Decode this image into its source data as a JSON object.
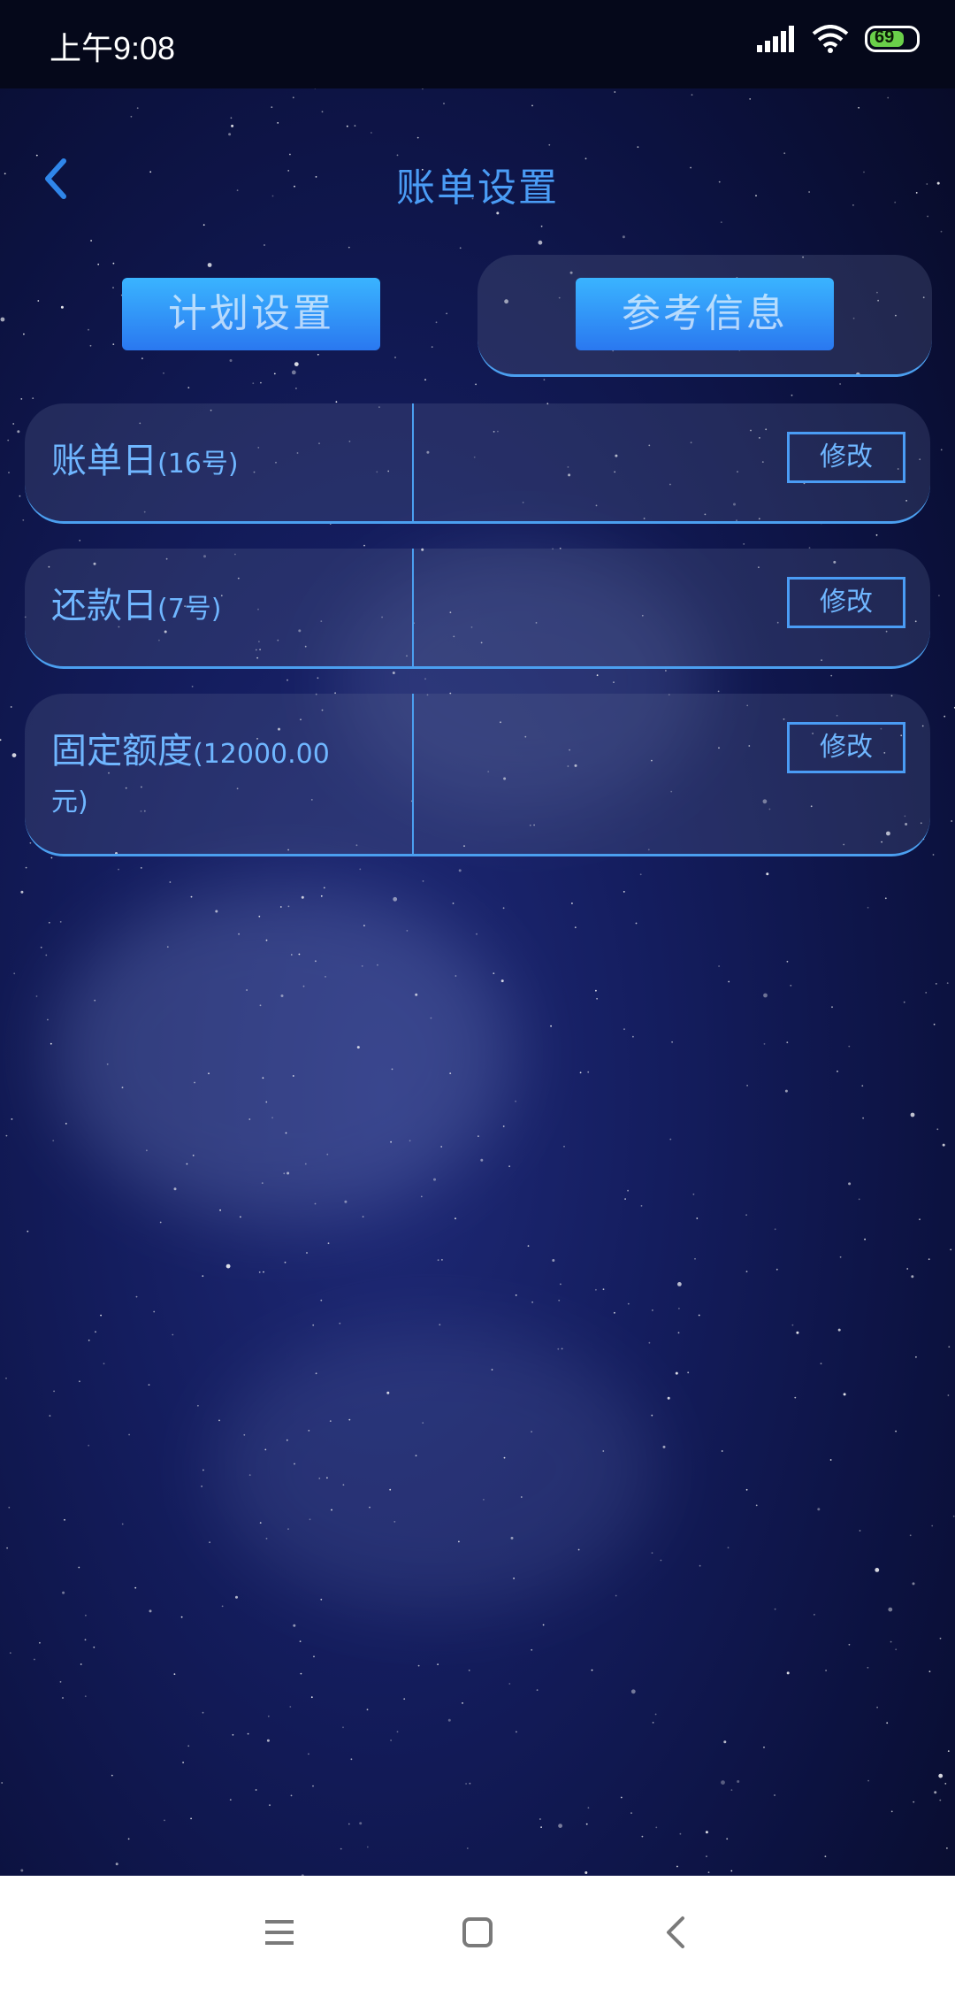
{
  "status_bar": {
    "time": "上午9:08",
    "battery_level": "69",
    "icons": [
      "signal-icon",
      "wifi-icon",
      "battery-icon"
    ]
  },
  "header": {
    "title": "账单设置",
    "back_icon": "chevron-left-icon"
  },
  "tabs": [
    {
      "label": "计划设置",
      "selected": false
    },
    {
      "label": "参考信息",
      "selected": true
    }
  ],
  "settings": [
    {
      "label": "账单日",
      "value": "(16号)",
      "action": "修改"
    },
    {
      "label": "还款日",
      "value": "(7号)",
      "action": "修改"
    },
    {
      "label": "固定额度",
      "value_line1": "(12000.00",
      "value_line2": "元)",
      "action": "修改"
    }
  ],
  "nav_bar": {
    "buttons": [
      "menu-icon",
      "home-icon",
      "back-icon"
    ]
  },
  "colors": {
    "accent": "#4a9cf5",
    "label_text": "#6fb6ff",
    "tab_gradient_top": "#3ab4ff",
    "tab_gradient_bottom": "#2a78f0",
    "background_dark": "#070a25",
    "background_mid": "#1f2a78"
  }
}
